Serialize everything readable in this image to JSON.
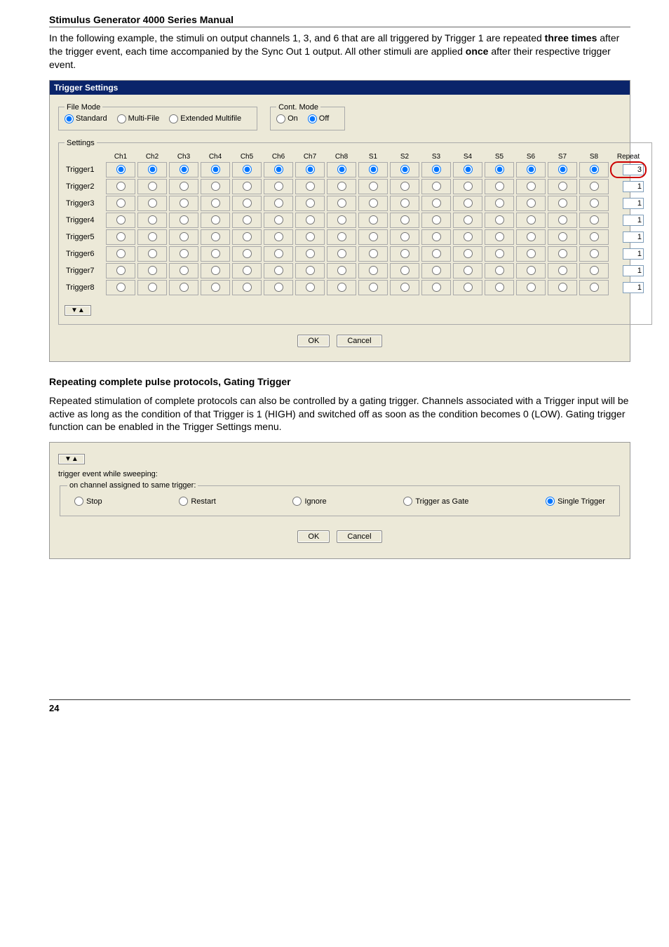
{
  "header": {
    "title": "Stimulus Generator 4000 Series Manual",
    "page_number": "24"
  },
  "intro_html_parts": [
    "In the following example, the stimuli on output channels 1, 3, and 6 that are all triggered by Trigger 1 are repeated ",
    "three times",
    " after the trigger event, each time accompanied by the Sync Out 1 output. All other stimuli are applied ",
    "once",
    " after their respective trigger event."
  ],
  "dlg1": {
    "title": "Trigger Settings",
    "filemode": {
      "legend": "File Mode",
      "options": [
        "Standard",
        "Multi-File",
        "Extended Multifile"
      ],
      "selected": 0
    },
    "contmode": {
      "legend": "Cont. Mode",
      "options": [
        "On",
        "Off"
      ],
      "selected": 1
    },
    "settings_legend": "Settings",
    "cols": [
      "Ch1",
      "Ch2",
      "Ch3",
      "Ch4",
      "Ch5",
      "Ch6",
      "Ch7",
      "Ch8",
      "S1",
      "S2",
      "S3",
      "S4",
      "S5",
      "S6",
      "S7",
      "S8"
    ],
    "repeat_header": "Repeat",
    "rows": [
      {
        "label": "Trigger1",
        "selected": [
          0,
          1,
          2,
          3,
          4,
          5,
          6,
          7,
          8,
          9,
          10,
          11,
          12,
          13,
          14,
          15
        ],
        "repeat": "3",
        "repeat_circled": true
      },
      {
        "label": "Trigger2",
        "selected": [],
        "repeat": "1"
      },
      {
        "label": "Trigger3",
        "selected": [],
        "repeat": "1"
      },
      {
        "label": "Trigger4",
        "selected": [],
        "repeat": "1"
      },
      {
        "label": "Trigger5",
        "selected": [],
        "repeat": "1"
      },
      {
        "label": "Trigger6",
        "selected": [],
        "repeat": "1"
      },
      {
        "label": "Trigger7",
        "selected": [],
        "repeat": "1"
      },
      {
        "label": "Trigger8",
        "selected": [],
        "repeat": "1"
      }
    ],
    "expand": "▼▲",
    "ok": "OK",
    "cancel": "Cancel"
  },
  "section2": {
    "heading": "Repeating complete pulse protocols, Gating Trigger",
    "para": "Repeated stimulation of complete protocols can also be controlled by a gating trigger. Channels associated with a Trigger input will be active as long as the condition of that Trigger is 1 (HIGH) and switched off as soon as the condition becomes 0 (LOW). Gating trigger function can be enabled in the Trigger Settings menu."
  },
  "dlg2": {
    "expand": "▼▲",
    "sweep_label": "trigger event while sweeping:",
    "fieldset_legend": "on channel assigned to same trigger:",
    "options": [
      "Stop",
      "Restart",
      "Ignore",
      "Trigger as Gate",
      "Single Trigger"
    ],
    "selected": 4,
    "ok": "OK",
    "cancel": "Cancel"
  }
}
